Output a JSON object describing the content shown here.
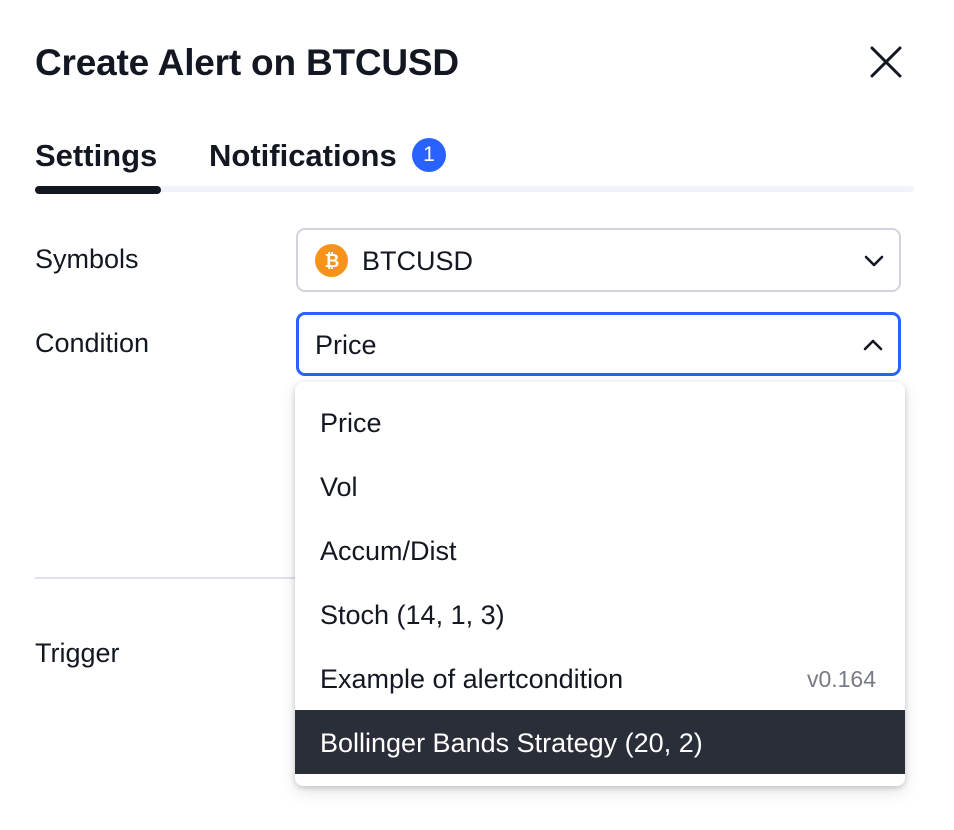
{
  "dialog": {
    "title": "Create Alert on BTCUSD",
    "close_icon": "close-icon"
  },
  "tabs": [
    {
      "label": "Settings",
      "active": true
    },
    {
      "label": "Notifications",
      "active": false,
      "badge": "1"
    }
  ],
  "form": {
    "symbols": {
      "label": "Symbols",
      "value": "BTCUSD",
      "icon": "bitcoin-icon",
      "icon_color": "#f7931a"
    },
    "condition": {
      "label": "Condition",
      "value": "Price",
      "expanded": true
    },
    "trigger": {
      "label": "Trigger"
    }
  },
  "dropdown": {
    "options": [
      {
        "label": "Price"
      },
      {
        "label": "Vol"
      },
      {
        "label": "Accum/Dist"
      },
      {
        "label": "Stoch (14, 1, 3)"
      },
      {
        "label": "Example of alertcondition",
        "meta": "v0.164"
      },
      {
        "label": "Bollinger Bands Strategy (20, 2)",
        "highlighted": true
      }
    ]
  },
  "colors": {
    "accent": "#2962ff",
    "text": "#131722",
    "muted": "#787b86",
    "highlight_bg": "#2a2e39",
    "border": "#d1d4dc"
  }
}
